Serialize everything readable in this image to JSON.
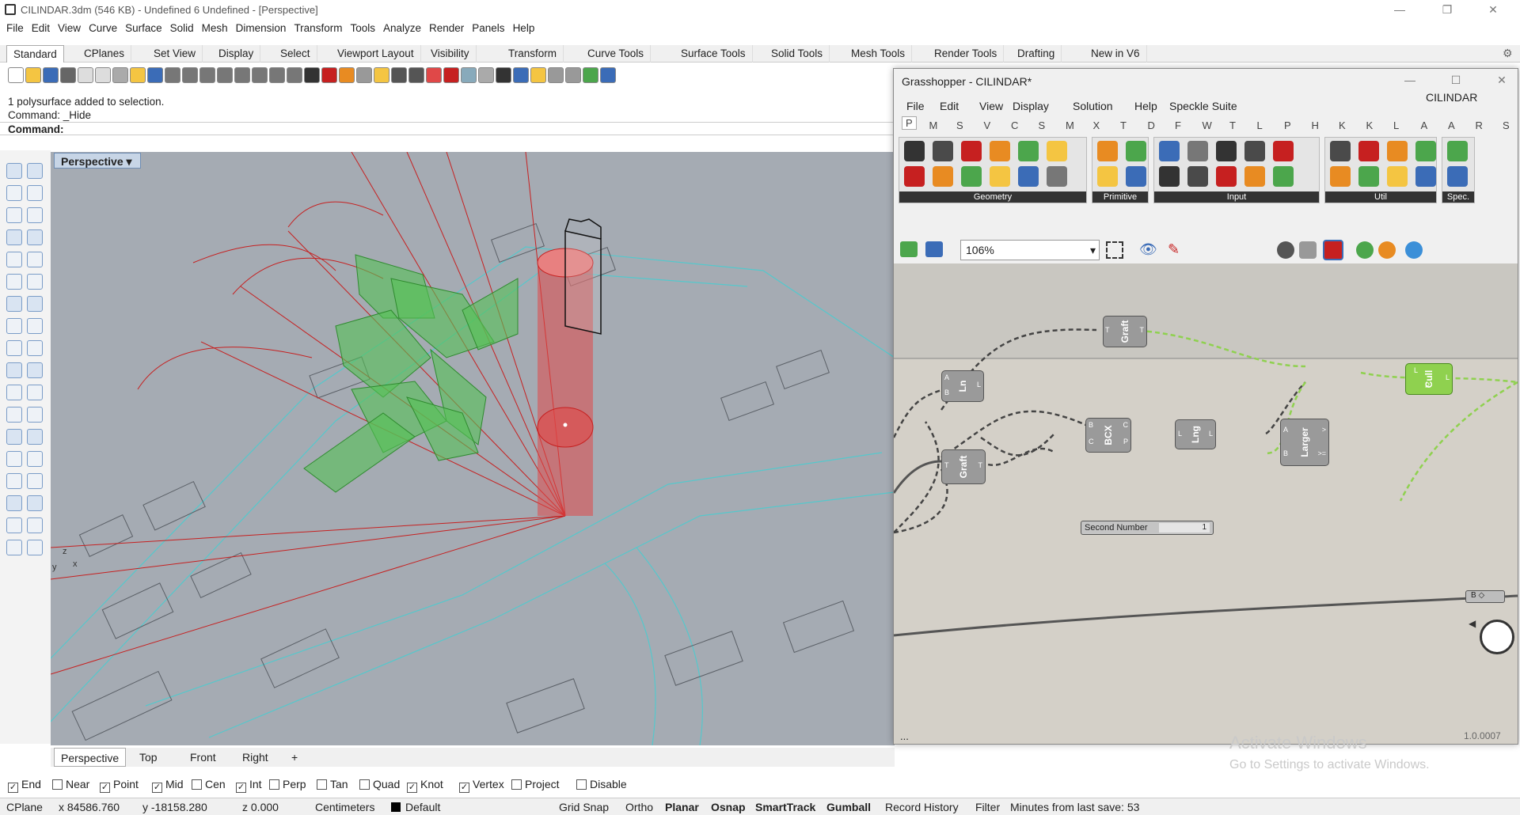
{
  "window": {
    "title": "CILINDAR.3dm (546 KB) - Undefined 6 Undefined - [Perspective]"
  },
  "menu": [
    "File",
    "Edit",
    "View",
    "Curve",
    "Surface",
    "Solid",
    "Mesh",
    "Dimension",
    "Transform",
    "Tools",
    "Analyze",
    "Render",
    "Panels",
    "Help"
  ],
  "tabs": [
    "Standard",
    "CPlanes",
    "Set View",
    "Display",
    "Select",
    "Viewport Layout",
    "Visibility",
    "Transform",
    "Curve Tools",
    "Surface Tools",
    "Solid Tools",
    "Mesh Tools",
    "Render Tools",
    "Drafting",
    "New in V6"
  ],
  "command": {
    "history1": "1 polysurface added to selection.",
    "history2": "Command: _Hide",
    "prompt": "Command:"
  },
  "viewport": {
    "label": "Perspective",
    "tabs": [
      "Perspective",
      "Top",
      "Front",
      "Right"
    ]
  },
  "osnap": [
    {
      "label": "End",
      "checked": true
    },
    {
      "label": "Near",
      "checked": false
    },
    {
      "label": "Point",
      "checked": true
    },
    {
      "label": "Mid",
      "checked": true
    },
    {
      "label": "Cen",
      "checked": false
    },
    {
      "label": "Int",
      "checked": true
    },
    {
      "label": "Perp",
      "checked": false
    },
    {
      "label": "Tan",
      "checked": false
    },
    {
      "label": "Quad",
      "checked": false
    },
    {
      "label": "Knot",
      "checked": true
    },
    {
      "label": "Vertex",
      "checked": true
    },
    {
      "label": "Project",
      "checked": false
    },
    {
      "label": "Disable",
      "checked": false
    }
  ],
  "status": {
    "cplane": "CPlane",
    "x": "x 84586.760",
    "y": "y -18158.280",
    "z": "z 0.000",
    "units": "Centimeters",
    "layer": "Default",
    "gridsnap": "Grid Snap",
    "ortho": "Ortho",
    "planar": "Planar",
    "osnap": "Osnap",
    "smarttrack": "SmartTrack",
    "gumball": "Gumball",
    "history": "Record History",
    "filter": "Filter",
    "save": "Minutes from last save: 53"
  },
  "grasshopper": {
    "title": "Grasshopper - CILINDAR*",
    "menu": [
      "File",
      "Edit",
      "View",
      "Display",
      "Solution",
      "Help",
      "Speckle Suite"
    ],
    "doc": "CILINDAR",
    "categories": [
      "P",
      "M",
      "S",
      "V",
      "C",
      "S",
      "M",
      "X",
      "T",
      "D",
      "F",
      "W",
      "T",
      "L",
      "P",
      "H",
      "K",
      "K",
      "L",
      "A",
      "A",
      "R",
      "S"
    ],
    "ribbon_groups": [
      "Geometry",
      "Primitive",
      "Input",
      "Util",
      "Spec."
    ],
    "zoom": "106%",
    "components": {
      "graft1": "Graft",
      "graft2": "Graft",
      "ln": "Ln",
      "bcx": "BCX",
      "lng": "Lng",
      "larger": "Larger",
      "cull": "Cull"
    },
    "slider": {
      "label": "Second Number",
      "value": "1"
    },
    "version": "1.0.0007",
    "status_left": "..."
  },
  "watermark": {
    "line1": "Activate Windows",
    "line2": "Go to Settings to activate Windows."
  },
  "colors": {
    "accent": "#3b6cb7",
    "gh_green": "#8fd14f",
    "building_green": "#55c255",
    "cylinder": "#e04848"
  }
}
